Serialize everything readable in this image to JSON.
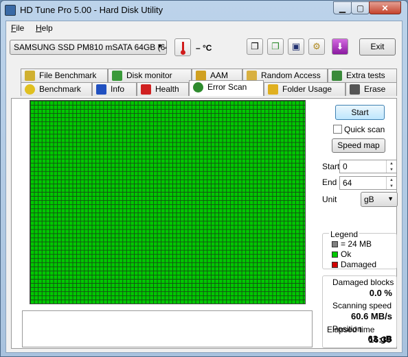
{
  "window": {
    "title": "HD Tune Pro 5.00 - Hard Disk Utility"
  },
  "menu": [
    {
      "label": "File",
      "underline": "F",
      "rest": "ile"
    },
    {
      "label": "Help",
      "underline": "H",
      "rest": "elp"
    }
  ],
  "toolbar": {
    "drive": "SAMSUNG SSD PM810 mSATA 64GB (64",
    "temperature": "– °C",
    "exit_label": "Exit"
  },
  "tabs_row1": [
    {
      "label": "File Benchmark",
      "icon": "file-benchmark-icon",
      "color": "#d0b030"
    },
    {
      "label": "Disk monitor",
      "icon": "disk-monitor-icon",
      "color": "#3a9a3a"
    },
    {
      "label": "AAM",
      "icon": "speaker-icon",
      "color": "#d0a020"
    },
    {
      "label": "Random Access",
      "icon": "random-access-icon",
      "color": "#d8b040"
    },
    {
      "label": "Extra tests",
      "icon": "extra-tests-icon",
      "color": "#3a8a3a"
    }
  ],
  "tabs_row2": [
    {
      "label": "Benchmark",
      "icon": "lightbulb-icon",
      "color": "#e0c020"
    },
    {
      "label": "Info",
      "icon": "info-icon",
      "color": "#2050c0"
    },
    {
      "label": "Health",
      "icon": "health-cross-icon",
      "color": "#d02020"
    },
    {
      "label": "Error Scan",
      "icon": "magnifier-icon",
      "color": "#2e8b2e"
    },
    {
      "label": "Folder Usage",
      "icon": "folder-icon",
      "color": "#e0b020"
    },
    {
      "label": "Erase",
      "icon": "trash-icon",
      "color": "#555555"
    }
  ],
  "error_scan": {
    "start_button": "Start",
    "quick_scan_label": "Quick scan",
    "speed_map_button": "Speed map",
    "start_label": "Start",
    "start_value": "0",
    "end_label": "End",
    "end_value": "64",
    "unit_label": "Unit",
    "unit_value": "gB",
    "block_color": "#00c800",
    "legend": {
      "title": "Legend",
      "items": [
        {
          "label": "= 24 MB",
          "color": "#808080"
        },
        {
          "label": "Ok",
          "color": "#00c800"
        },
        {
          "label": "Damaged",
          "color": "#d00000"
        }
      ]
    },
    "stats": {
      "damaged_blocks_label": "Damaged blocks",
      "damaged_blocks_value": "0.0 %",
      "scanning_speed_label": "Scanning speed",
      "scanning_speed_value": "60.6 MB/s",
      "position_label": "Position",
      "position_value": "63 gB",
      "elapsed_time_label": "Elapsed time",
      "elapsed_time_value": "16:39"
    }
  }
}
